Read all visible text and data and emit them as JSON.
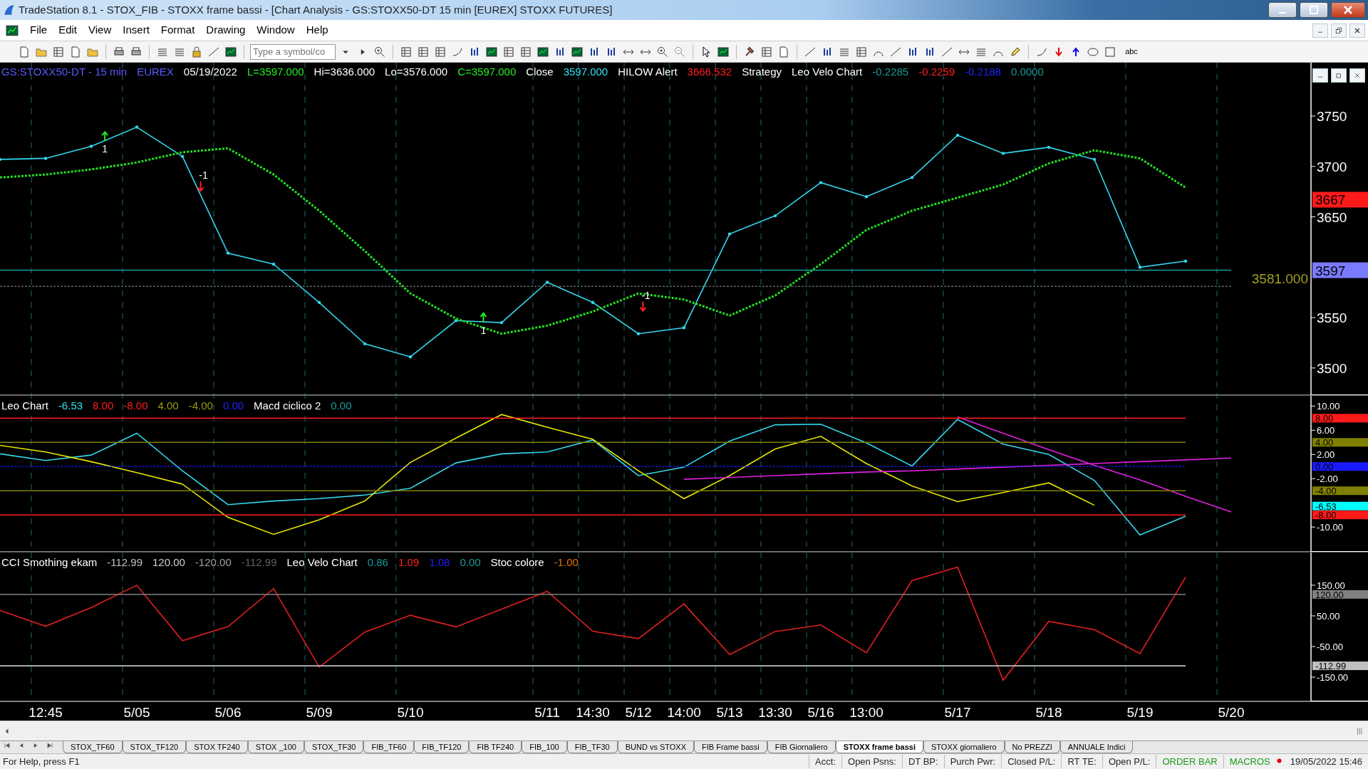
{
  "window": {
    "title": "TradeStation 8.1 - STOX_FIB - STOXX frame bassi - [Chart Analysis - GS:STOXX50-DT  15 min  [EUREX] STOXX FUTURES]"
  },
  "menu": [
    "File",
    "Edit",
    "View",
    "Insert",
    "Format",
    "Drawing",
    "Window",
    "Help"
  ],
  "toolbar": {
    "symbol_placeholder": "Type a symbol/co",
    "text_tool": "abc"
  },
  "panels": [
    {
      "legend": [
        {
          "text": "GS:STOXX50-DT - 15 min",
          "color": "#5a5aff"
        },
        {
          "text": "EUREX",
          "color": "#5a5aff"
        },
        {
          "text": "05/19/2022",
          "color": "#ffffff"
        },
        {
          "text": "L=3597.000",
          "color": "#22ee22"
        },
        {
          "text": "Hi=3636.000",
          "color": "#ffffff"
        },
        {
          "text": "Lo=3576.000",
          "color": "#ffffff"
        },
        {
          "text": "C=3597.000",
          "color": "#22ee22"
        },
        {
          "text": "Close",
          "color": "#ffffff"
        },
        {
          "text": "3597.000",
          "color": "#33e0f0"
        },
        {
          "text": "HILOW Alert",
          "color": "#ffffff"
        },
        {
          "text": "3666.532",
          "color": "#ff2020"
        },
        {
          "text": "Strategy",
          "color": "#ffffff"
        },
        {
          "text": "Leo Velo Chart",
          "color": "#ffffff"
        },
        {
          "text": "-0.2285",
          "color": "#1a9a9a"
        },
        {
          "text": "-0.2259",
          "color": "#ff2020"
        },
        {
          "text": "-0.2188",
          "color": "#2020ff"
        },
        {
          "text": "0.0000",
          "color": "#1a9a9a"
        }
      ],
      "axis_badges": [
        {
          "label": "3667",
          "color": "#ff1a1a"
        },
        {
          "label": "3597",
          "color": "#7a7aff"
        }
      ],
      "price_label": {
        "text": "3581.000",
        "color": "#a0a020"
      },
      "signals": [
        {
          "text": "1",
          "kind": "buy"
        },
        {
          "text": "-1",
          "kind": "sell"
        },
        {
          "text": "1",
          "kind": "buy"
        },
        {
          "text": "-1",
          "kind": "sell"
        }
      ],
      "chart_data": {
        "type": "line",
        "ylim": [
          3473,
          3803
        ],
        "yticks": [
          3500,
          3550,
          3650,
          3700,
          3750
        ],
        "categories": [
          null,
          null,
          null,
          null,
          null,
          null,
          null,
          null,
          null,
          null,
          null,
          null,
          null,
          null,
          null,
          null,
          null,
          null,
          null,
          null,
          null,
          null,
          null,
          null,
          null,
          null,
          null,
          null
        ],
        "series": [
          {
            "color": "#33d6ee",
            "values": [
              3707,
              3708,
              3720,
              3739,
              3710,
              3614,
              3603,
              3565,
              3524,
              3511,
              3547,
              3545,
              3585,
              3565,
              3534,
              3540,
              3633,
              3651,
              3684,
              3670,
              3689,
              3731,
              3713,
              3719,
              3707,
              3600,
              3606,
              null
            ]
          },
          {
            "color": "#22dd22",
            "line_style": "dotted",
            "values": [
              3689,
              3692,
              3697,
              3704,
              3714,
              3718,
              3692,
              3656,
              3616,
              3574,
              3549,
              3534,
              3542,
              3556,
              3574,
              3568,
              3552,
              3572,
              3603,
              3637,
              3656,
              3669,
              3682,
              3703,
              3716,
              3708,
              3679,
              null
            ]
          },
          {
            "color": "#1a9a9a",
            "values": [
              3597,
              3597,
              3597,
              3597,
              3597,
              3597,
              3597,
              3597,
              3597,
              3597,
              3597,
              3597,
              3597,
              3597,
              3597,
              3597,
              3597,
              3597,
              3597,
              3597,
              3597,
              3597,
              3597,
              3597,
              3597,
              3597,
              3597,
              3597
            ]
          },
          {
            "color": "#777777",
            "line_style": "dotted",
            "values": [
              3581,
              3581,
              3581,
              3581,
              3581,
              3581,
              3581,
              3581,
              3581,
              3581,
              3581,
              3581,
              3581,
              3581,
              3581,
              3581,
              3581,
              3581,
              3581,
              3581,
              3581,
              3581,
              3581,
              3581,
              3581,
              3581,
              3581,
              3581
            ]
          }
        ]
      }
    },
    {
      "legend": [
        {
          "text": "Leo Chart",
          "color": "#ffffff"
        },
        {
          "text": "-6.53",
          "color": "#33e0f0"
        },
        {
          "text": "8.00",
          "color": "#ff2020"
        },
        {
          "text": "-8.00",
          "color": "#ff2020"
        },
        {
          "text": "4.00",
          "color": "#9a9a10"
        },
        {
          "text": "-4.00",
          "color": "#9a9a10"
        },
        {
          "text": "0.00",
          "color": "#2020ff"
        },
        {
          "text": "Macd ciclico 2",
          "color": "#ffffff"
        },
        {
          "text": "0.00",
          "color": "#1a9a9a"
        }
      ],
      "axis_badges": [
        {
          "label": "8.00",
          "color": "#ff1a1a"
        },
        {
          "label": "4.00",
          "color": "#808000"
        },
        {
          "label": "0.00",
          "color": "#1a1aff"
        },
        {
          "label": "-4.00",
          "color": "#808000"
        },
        {
          "label": "-6.53",
          "color": "#00ffff"
        },
        {
          "label": "-8.00",
          "color": "#ff1a1a"
        }
      ],
      "chart_data": {
        "type": "line",
        "ylim": [
          -14.1,
          11.8
        ],
        "yticks": [
          {
            "value": 10,
            "label": "10.00"
          },
          {
            "value": 6,
            "label": "6.00"
          },
          {
            "value": 2,
            "label": "2.00"
          },
          {
            "value": -2,
            "label": "-2.00"
          },
          {
            "value": -10,
            "label": "-10.00"
          }
        ],
        "categories": [
          null,
          null,
          null,
          null,
          null,
          null,
          null,
          null,
          null,
          null,
          null,
          null,
          null,
          null,
          null,
          null,
          null,
          null,
          null,
          null,
          null,
          null,
          null,
          null,
          null,
          null,
          null,
          null
        ],
        "series": [
          {
            "color": "#33d6ee",
            "values": [
              2.1,
              1.0,
              1.9,
              5.5,
              -0.7,
              -6.3,
              -5.7,
              -5.3,
              -4.7,
              -3.6,
              0.6,
              2.1,
              2.4,
              4.4,
              -1.5,
              -0.1,
              4.2,
              6.9,
              7.0,
              3.9,
              0.1,
              7.8,
              3.7,
              2.0,
              -2.3,
              -11.3,
              -8.2,
              null
            ]
          },
          {
            "color": "#e6e600",
            "values": [
              3.5,
              2.4,
              0.8,
              -1.0,
              -2.9,
              -8.4,
              -11.2,
              -8.8,
              -5.7,
              0.7,
              4.7,
              8.6,
              6.5,
              4.5,
              -0.7,
              -5.3,
              -1.5,
              2.9,
              5.0,
              0.5,
              -3.2,
              -5.8,
              -4.3,
              -2.7,
              -6.4,
              null,
              null,
              null
            ]
          },
          {
            "color": "#e020e0",
            "values": [
              null,
              null,
              null,
              null,
              null,
              null,
              null,
              null,
              null,
              null,
              null,
              null,
              null,
              null,
              null,
              -2.1,
              -1.8,
              -1.5,
              -1.2,
              -0.9,
              -0.7,
              -0.4,
              -0.1,
              0.2,
              0.5,
              0.8,
              1.1,
              1.4
            ]
          },
          {
            "color": "#e020e0",
            "values": [
              null,
              null,
              null,
              null,
              null,
              null,
              null,
              null,
              null,
              null,
              null,
              null,
              null,
              null,
              null,
              null,
              null,
              null,
              null,
              null,
              null,
              8.2,
              5.5,
              2.8,
              0.2,
              -2.2,
              -4.9,
              -7.5
            ]
          },
          {
            "color": "#ff1a1a",
            "values": [
              8,
              8,
              8,
              8,
              8,
              8,
              8,
              8,
              8,
              8,
              8,
              8,
              8,
              8,
              8,
              8,
              8,
              8,
              8,
              8,
              8,
              8,
              8,
              8,
              8,
              8,
              8,
              null
            ]
          },
          {
            "color": "#808000",
            "values": [
              4,
              4,
              4,
              4,
              4,
              4,
              4,
              4,
              4,
              4,
              4,
              4,
              4,
              4,
              4,
              4,
              4,
              4,
              4,
              4,
              4,
              4,
              4,
              4,
              4,
              4,
              4,
              null
            ]
          },
          {
            "color": "#1a1aff",
            "line_style": "dotted",
            "values": [
              0,
              0,
              0,
              0,
              0,
              0,
              0,
              0,
              0,
              0,
              0,
              0,
              0,
              0,
              0,
              0,
              0,
              0,
              0,
              0,
              0,
              0,
              0,
              0,
              0,
              0,
              0,
              null
            ]
          },
          {
            "color": "#808000",
            "values": [
              -4,
              -4,
              -4,
              -4,
              -4,
              -4,
              -4,
              -4,
              -4,
              -4,
              -4,
              -4,
              -4,
              -4,
              -4,
              -4,
              -4,
              -4,
              -4,
              -4,
              -4,
              -4,
              -4,
              -4,
              -4,
              -4,
              -4,
              null
            ]
          },
          {
            "color": "#ff1a1a",
            "values": [
              -8,
              -8,
              -8,
              -8,
              -8,
              -8,
              -8,
              -8,
              -8,
              -8,
              -8,
              -8,
              -8,
              -8,
              -8,
              -8,
              -8,
              -8,
              -8,
              -8,
              -8,
              -8,
              -8,
              -8,
              -8,
              -8,
              -8,
              null
            ]
          }
        ]
      }
    },
    {
      "legend": [
        {
          "text": "CCI Smothing ekam",
          "color": "#ffffff"
        },
        {
          "text": "-112.99",
          "color": "#c0c0c0"
        },
        {
          "text": "120.00",
          "color": "#d0d0d0"
        },
        {
          "text": "-120.00",
          "color": "#a0a0a0"
        },
        {
          "text": "-112.99",
          "color": "#606060"
        },
        {
          "text": "Leo Velo Chart",
          "color": "#ffffff"
        },
        {
          "text": "0.86",
          "color": "#1a9a9a"
        },
        {
          "text": "1.09",
          "color": "#ff2020"
        },
        {
          "text": "1.08",
          "color": "#2020ff"
        },
        {
          "text": "0.00",
          "color": "#1a9a9a"
        },
        {
          "text": "Stoc colore",
          "color": "#ffffff"
        },
        {
          "text": "-1.00",
          "color": "#e07000"
        }
      ],
      "axis_badges": [
        {
          "label": "120.00",
          "color": "#808080"
        },
        {
          "label": "-112.99",
          "color": "#c0c0c0"
        }
      ],
      "chart_data": {
        "type": "line",
        "ylim": [
          -229,
          259
        ],
        "yticks": [
          {
            "value": 150,
            "label": "150.00"
          },
          {
            "value": 50,
            "label": "50.00"
          },
          {
            "value": -50,
            "label": "-50.00"
          },
          {
            "value": -150,
            "label": "-150.00"
          }
        ],
        "categories": [
          null,
          "12:45",
          null,
          "5/05",
          null,
          "5/06",
          null,
          "5/09",
          null,
          "5/10",
          null,
          null,
          "5/11",
          "14:30",
          "5/12",
          "14:00",
          "5/13",
          "13:30",
          "5/16",
          "13:00",
          null,
          "5/17",
          null,
          "5/18",
          null,
          "5/19",
          null,
          "5/20"
        ],
        "series": [
          {
            "color": "#e02020",
            "values": [
              68,
              16,
              77,
              150,
              -31,
              15,
              139,
              -117,
              -3,
              52,
              14,
              72,
              130,
              0,
              -24,
              89,
              -76,
              -1,
              20,
              -70,
              165,
              209,
              -160,
              32,
              5,
              -73,
              176,
              null
            ]
          },
          {
            "color": "#808080",
            "values": [
              120,
              120,
              120,
              120,
              120,
              120,
              120,
              120,
              120,
              120,
              120,
              120,
              120,
              120,
              120,
              120,
              120,
              120,
              120,
              120,
              120,
              120,
              120,
              120,
              120,
              120,
              120,
              null
            ]
          },
          {
            "color": "#c0c0c0",
            "values": [
              -112.99,
              -112.99,
              -112.99,
              -112.99,
              -112.99,
              -112.99,
              -112.99,
              -112.99,
              -112.99,
              -112.99,
              -112.99,
              -112.99,
              -112.99,
              -112.99,
              -112.99,
              -112.99,
              -112.99,
              -112.99,
              -112.99,
              -112.99,
              -112.99,
              -112.99,
              -112.99,
              -112.99,
              -112.99,
              -112.99,
              -112.99,
              null
            ]
          }
        ]
      }
    }
  ],
  "sheet_tabs": [
    {
      "label": "STOX_TF60",
      "selected": false
    },
    {
      "label": "STOX_TF120",
      "selected": false
    },
    {
      "label": "STOX TF240",
      "selected": false
    },
    {
      "label": "STOX _100",
      "selected": false
    },
    {
      "label": "STOX_TF30",
      "selected": false
    },
    {
      "label": "FIB_TF60",
      "selected": false
    },
    {
      "label": "FIB_TF120",
      "selected": false
    },
    {
      "label": "FIB TF240",
      "selected": false
    },
    {
      "label": "FIB_100",
      "selected": false
    },
    {
      "label": "FIB_TF30",
      "selected": false
    },
    {
      "label": "BUND vs STOXX",
      "selected": false
    },
    {
      "label": "FIB Frame bassi",
      "selected": false
    },
    {
      "label": "FIB Giornaliero",
      "selected": false
    },
    {
      "label": "STOXX frame bassi",
      "selected": true
    },
    {
      "label": "STOXX giornaliero",
      "selected": false
    },
    {
      "label": "No PREZZI",
      "selected": false
    },
    {
      "label": "ANNUALE Indici",
      "selected": false
    }
  ],
  "status_bar": {
    "help": "For Help, press F1",
    "fields": [
      {
        "text": "Acct:",
        "kind": "label"
      },
      {
        "text": "Open Psns:",
        "kind": "label"
      },
      {
        "text": "DT BP:",
        "kind": "label"
      },
      {
        "text": "Purch Pwr:",
        "kind": "label"
      },
      {
        "text": "Closed P/L:",
        "kind": "label"
      },
      {
        "text": "RT TE:",
        "kind": "label"
      },
      {
        "text": "Open P/L:",
        "kind": "label"
      },
      {
        "text": "ORDER BAR",
        "kind": "indicator"
      },
      {
        "text": "MACROS",
        "kind": "indicator"
      }
    ],
    "time": "19/05/2022 15:46"
  }
}
